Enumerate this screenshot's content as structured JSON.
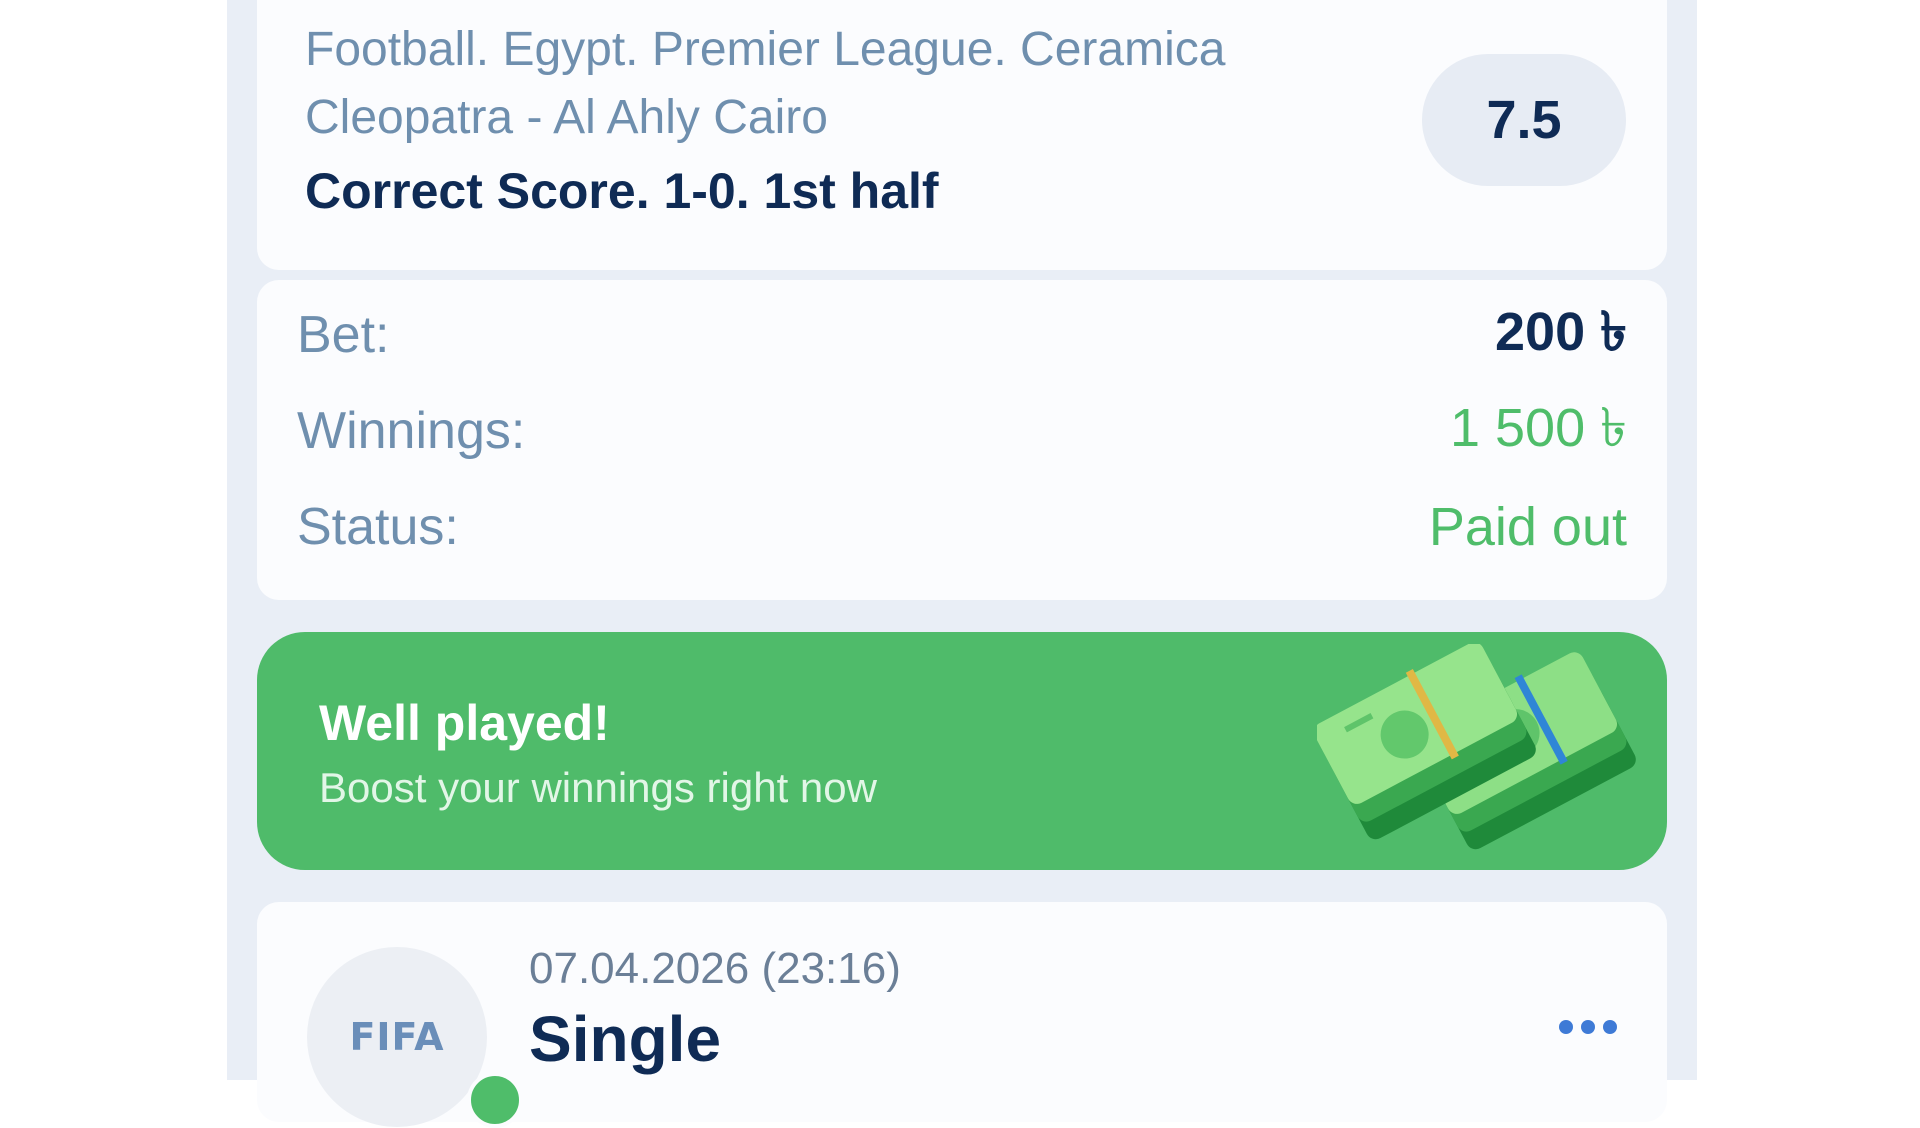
{
  "event_card": {
    "title": "Football. Egypt. Premier League. Ceramica Cleopatra - Al Ahly Cairo",
    "market": "Correct Score. 1-0. 1st half",
    "odds": "7.5"
  },
  "summary": {
    "bet_label": "Bet:",
    "bet_value": "200 ৳",
    "winnings_label": "Winnings:",
    "winnings_value": "1 500 ৳",
    "status_label": "Status:",
    "status_value": "Paid out"
  },
  "banner": {
    "title": "Well played!",
    "subtitle": "Boost your winnings right now",
    "icon": "cash-stack-icon"
  },
  "bet_card": {
    "avatar_label": "FIFA",
    "date": "07.04.2026 (23:16)",
    "type": "Single",
    "more_icon": "more-dots-icon"
  },
  "colors": {
    "accent_green": "#4fbd6a",
    "text_dark": "#0f2b55",
    "text_muted": "#6f8fae",
    "link_blue": "#3e7ad6"
  }
}
